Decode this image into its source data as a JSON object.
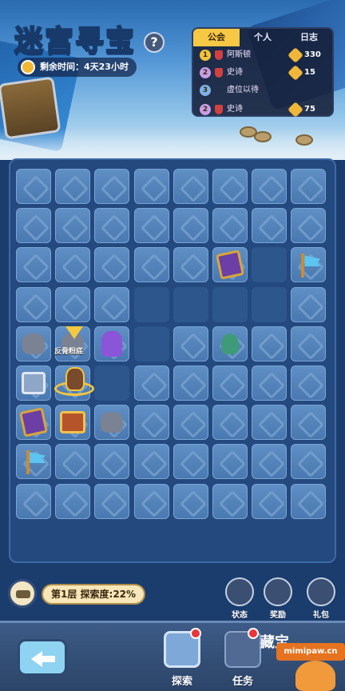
{
  "header": {
    "title_part1": "迷宫",
    "title_part2": "寻宝",
    "help_label": "?",
    "timer_text": "剩余时间：4天23小时"
  },
  "rank_panel": {
    "tabs": [
      {
        "label": "公会",
        "active": true
      },
      {
        "label": "个人",
        "active": false
      },
      {
        "label": "日志",
        "active": false
      }
    ],
    "rows": [
      {
        "rank": "1",
        "rank_color": "#f2c33a",
        "name": "阿斯顿",
        "score": "330",
        "has_shield": true,
        "has_score": true
      },
      {
        "rank": "2",
        "rank_color": "#c99de6",
        "name": "史诗",
        "score": "15",
        "has_shield": true,
        "has_score": true
      },
      {
        "rank": "3",
        "rank_color": "#7fb2e6",
        "name": "虚位以待",
        "score": "",
        "has_shield": false,
        "has_score": false
      },
      {
        "rank": "2",
        "rank_color": "#c99de6",
        "name": "史诗",
        "score": "75",
        "has_shield": true,
        "has_score": true
      }
    ]
  },
  "board": {
    "hero_label": "反骨粉底"
  },
  "status_bar": {
    "floor_text": "第1层 探索度:22%",
    "buttons": [
      {
        "label": "状态",
        "icon": "ghost-icon"
      },
      {
        "label": "奖励",
        "icon": "tools-icon"
      },
      {
        "label": "礼包",
        "icon": "gift-icon"
      }
    ]
  },
  "bottom_nav": {
    "items": [
      {
        "label": "探索",
        "active": true,
        "badge": true
      },
      {
        "label": "任务",
        "active": false,
        "badge": true
      }
    ],
    "right_text": "藏宝"
  },
  "watermark": "mimipaw.cn",
  "colors": {
    "accent_gold": "#ffd13b",
    "board_bg": "#23497e",
    "tile": "#5f8fc4",
    "badge_red": "#e8363a"
  }
}
